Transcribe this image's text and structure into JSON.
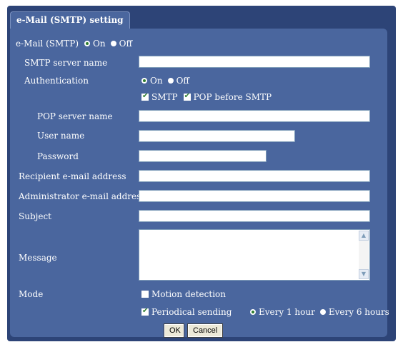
{
  "tab": {
    "label": "e-Mail (SMTP) setting"
  },
  "smtp_toggle": {
    "label": "e-Mail (SMTP)",
    "on_label": "On",
    "off_label": "Off",
    "selected": "On"
  },
  "fields": {
    "smtp_server": {
      "label": "SMTP server name",
      "value": ""
    },
    "authentication": {
      "label": "Authentication",
      "on_label": "On",
      "off_label": "Off",
      "selected": "On"
    },
    "auth_methods": {
      "smtp_label": "SMTP",
      "smtp_checked": true,
      "pop_label": "POP before SMTP",
      "pop_checked": true
    },
    "pop_server": {
      "label": "POP server name",
      "value": ""
    },
    "user_name": {
      "label": "User name",
      "value": ""
    },
    "password": {
      "label": "Password",
      "value": ""
    },
    "recipient": {
      "label": "Recipient e-mail address",
      "value": ""
    },
    "administrator": {
      "label": "Administrator e-mail address",
      "value": ""
    },
    "subject": {
      "label": "Subject",
      "value": ""
    },
    "message": {
      "label": "Message",
      "value": ""
    }
  },
  "mode": {
    "label": "Mode",
    "motion_label": "Motion detection",
    "motion_checked": false,
    "periodical_label": "Periodical sending",
    "periodical_checked": true,
    "every1_label": "Every 1 hour",
    "every6_label": "Every 6 hours",
    "interval_selected": "Every 1 hour"
  },
  "buttons": {
    "ok": "OK",
    "cancel": "Cancel"
  },
  "colors": {
    "frame": "#2d4477",
    "panel": "#4a669e",
    "radio_dot": "#2e7d2e"
  }
}
